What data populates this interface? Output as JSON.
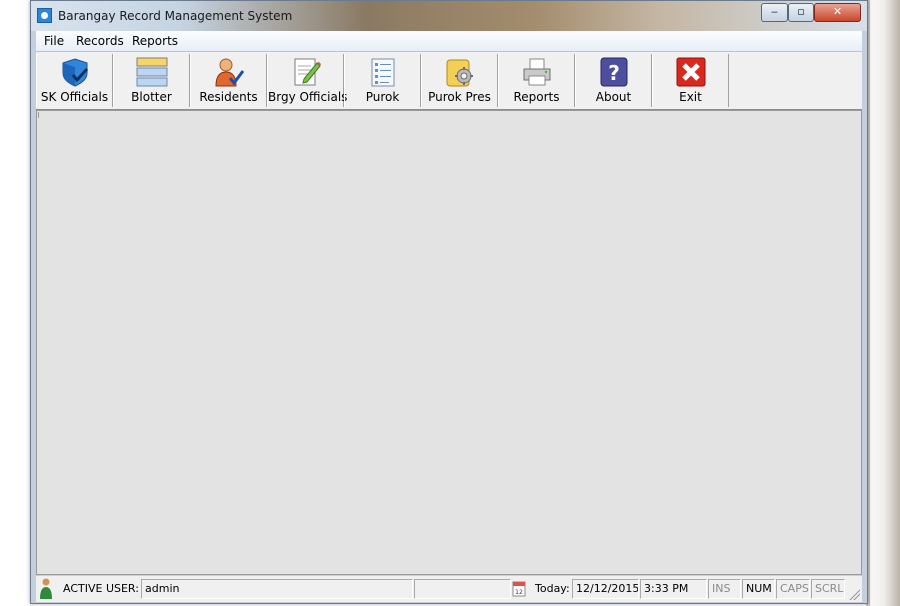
{
  "window": {
    "title": "Barangay Record Management System"
  },
  "menu": {
    "items": [
      "File",
      "Records",
      "Reports"
    ]
  },
  "toolbar": {
    "buttons": [
      {
        "label": "SK Officials",
        "icon": "shield-check-icon"
      },
      {
        "label": "Blotter",
        "icon": "stacked-records-icon"
      },
      {
        "label": "Residents",
        "icon": "person-check-icon"
      },
      {
        "label": "Brgy Officials",
        "icon": "document-pen-icon"
      },
      {
        "label": "Purok",
        "icon": "list-document-icon"
      },
      {
        "label": "Purok Pres",
        "icon": "folder-gear-icon"
      },
      {
        "label": "Reports",
        "icon": "printer-icon"
      },
      {
        "label": "About",
        "icon": "question-icon"
      },
      {
        "label": "Exit",
        "icon": "close-x-icon"
      }
    ]
  },
  "statusbar": {
    "active_user_label": "ACTIVE USER:",
    "active_user": "admin",
    "today_label": "Today:",
    "date": "12/12/2015",
    "time": "3:33 PM",
    "ins": "INS",
    "num": "NUM",
    "caps": "CAPS",
    "scrl": "SCRL"
  },
  "colors": {
    "client_area": "#e3e3e3",
    "toolbar": "#f0f0f0",
    "exit_red": "#d9281e",
    "about_purple": "#4b4f9e"
  }
}
